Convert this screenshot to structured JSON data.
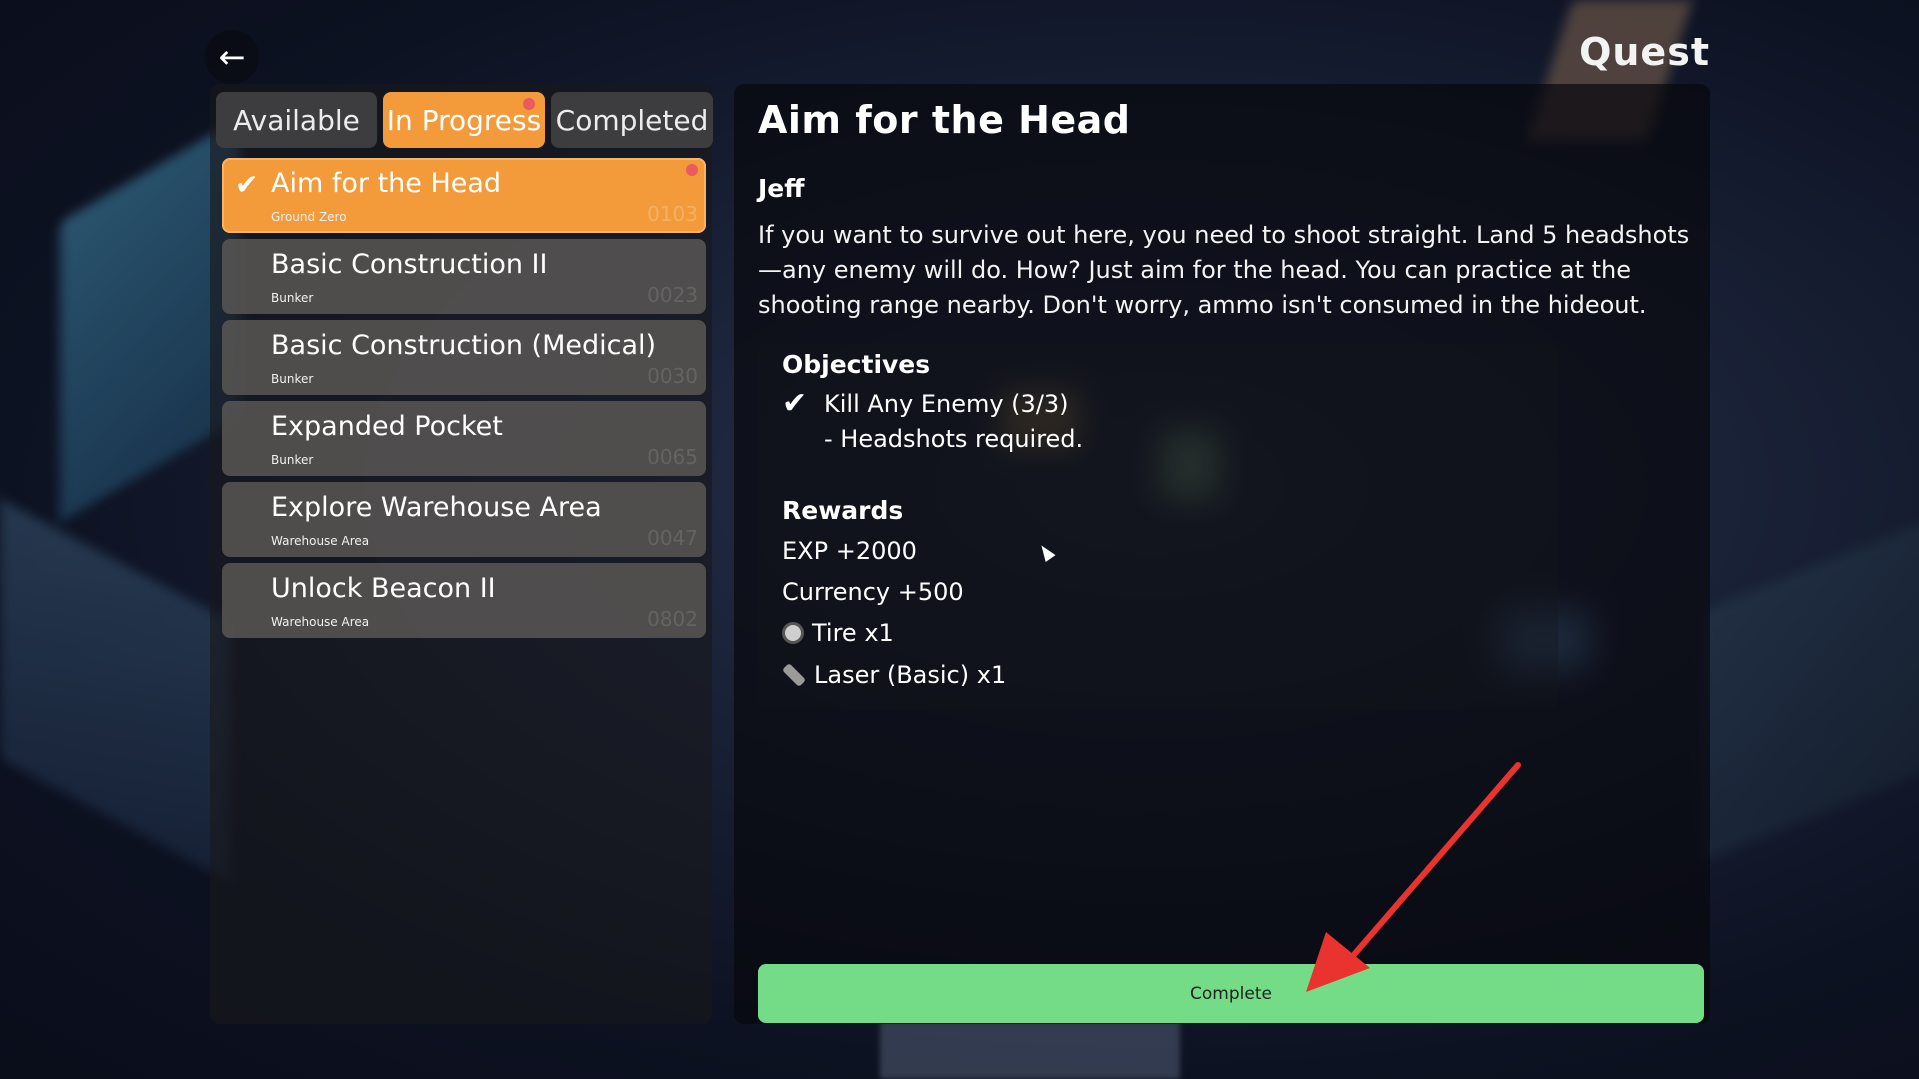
{
  "header": {
    "title": "Quest",
    "back_icon": "←"
  },
  "tabs": [
    {
      "label": "Available",
      "active": false,
      "has_notification": false
    },
    {
      "label": "In Progress",
      "active": true,
      "has_notification": true
    },
    {
      "label": "Completed",
      "active": false,
      "has_notification": false
    }
  ],
  "quests": [
    {
      "name": "Aim for the Head",
      "location": "Ground Zero",
      "code": "0103",
      "active": true,
      "checked": true
    },
    {
      "name": "Basic Construction II",
      "location": "Bunker",
      "code": "0023",
      "active": false,
      "checked": false
    },
    {
      "name": "Basic Construction (Medical)",
      "location": "Bunker",
      "code": "0030",
      "active": false,
      "checked": false
    },
    {
      "name": "Expanded Pocket",
      "location": "Bunker",
      "code": "0065",
      "active": false,
      "checked": false
    },
    {
      "name": "Explore Warehouse Area",
      "location": "Warehouse Area",
      "code": "0047",
      "active": false,
      "checked": false
    },
    {
      "name": "Unlock Beacon II",
      "location": "Warehouse Area",
      "code": "0802",
      "active": false,
      "checked": false
    }
  ],
  "detail": {
    "title": "Aim for the Head",
    "giver": "Jeff",
    "description": "If you want to survive out here, you need to shoot straight. Land 5 headshots—any enemy will do. How? Just aim for the head. You can practice at the shooting range nearby. Don't worry, ammo isn't consumed in the hideout.",
    "objectives_heading": "Objectives",
    "objective": {
      "text": "Kill Any Enemy (3/3)",
      "note": "- Headshots required.",
      "completed": true
    },
    "rewards_heading": "Rewards",
    "rewards": {
      "exp": "EXP +2000",
      "currency": "Currency +500",
      "items": [
        {
          "label": "Tire x1",
          "icon": "tire-icon"
        },
        {
          "label": "Laser (Basic) x1",
          "icon": "laser-icon"
        }
      ]
    }
  },
  "complete_button": {
    "label": "Complete",
    "color": "#74dc86"
  },
  "colors": {
    "accent": "#f39a3a",
    "notification": "#ea5a60",
    "annotation_arrow": "#e8332e"
  }
}
